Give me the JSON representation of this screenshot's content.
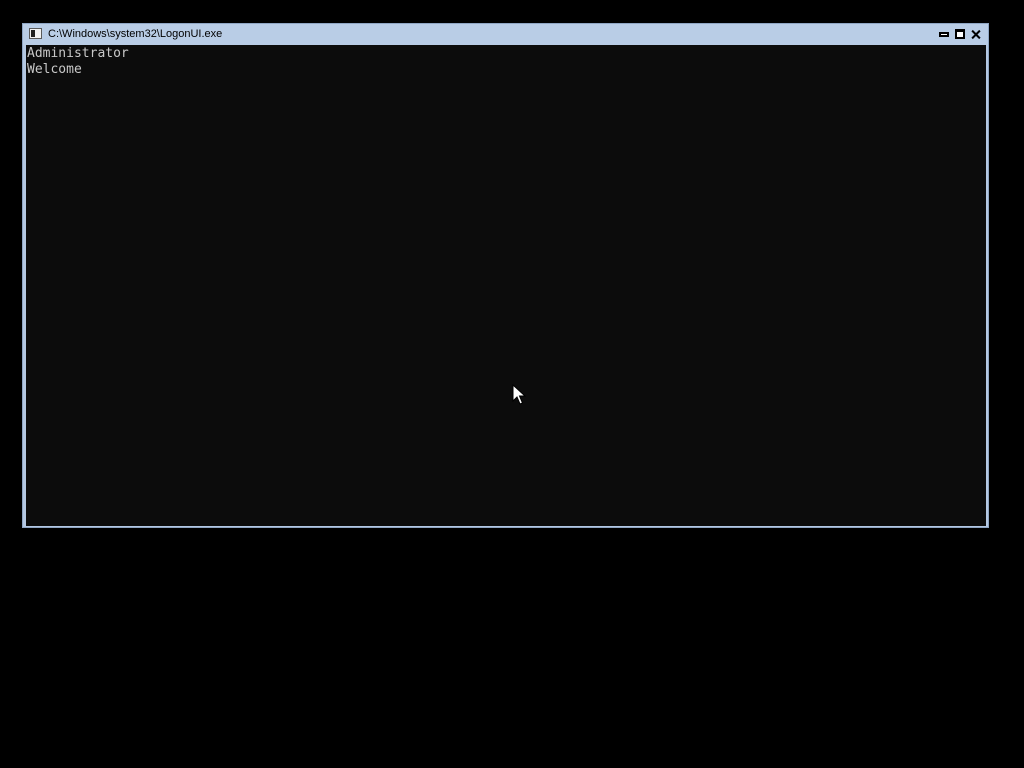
{
  "window": {
    "title": "C:\\Windows\\system32\\LogonUI.exe",
    "controls": {
      "minimize_icon": "minimize-icon",
      "maximize_icon": "maximize-icon",
      "close_icon": "close-icon"
    }
  },
  "console": {
    "lines": [
      "Administrator",
      "Welcome"
    ],
    "background": "#0c0c0c",
    "text_color": "#c8c8c8"
  },
  "colors": {
    "desktop": "#000000",
    "frame": "#b9cde6"
  }
}
